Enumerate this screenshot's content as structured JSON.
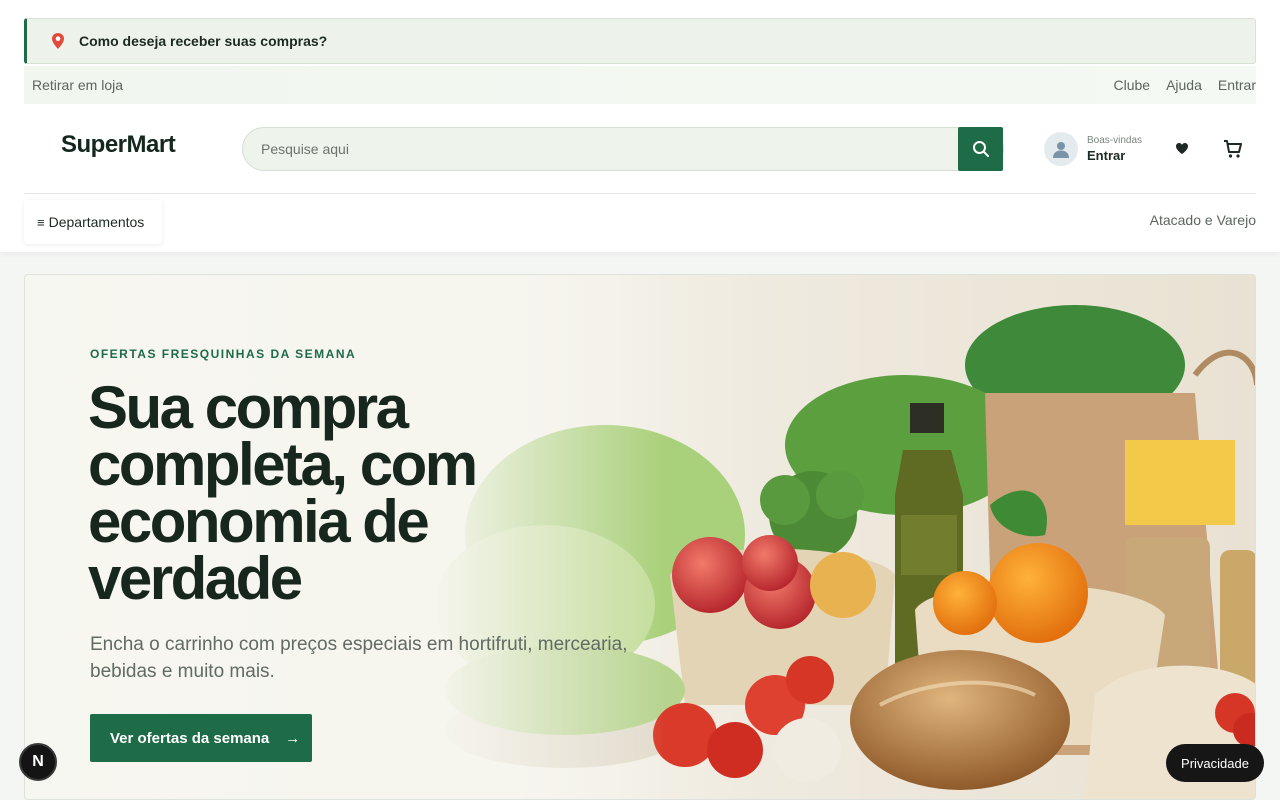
{
  "delivery": {
    "prompt": "Como deseja receber suas compras?",
    "icon": "map-pin-icon"
  },
  "utility": {
    "pickup": "Retirar em loja",
    "links": [
      "Clube",
      "Ajuda",
      "Entrar"
    ]
  },
  "header": {
    "logo": "SuperMart",
    "search_placeholder": "Pesquise aqui",
    "account_greeting": "Boas-vindas",
    "account_action": "Entrar",
    "icons": [
      "search-icon",
      "user-icon",
      "heart-icon",
      "cart-icon"
    ]
  },
  "nav": {
    "departments": "Departamentos",
    "departments_icon": "≡",
    "atacado": "Atacado e Varejo"
  },
  "hero": {
    "eyebrow": "OFERTAS FRESQUINHAS DA SEMANA",
    "headline": "Sua compra completa, com economia de verdade",
    "subtext": "Encha o carrinho com preços especiais em hortifruti, mercearia, bebidas e muito mais.",
    "cta": "Ver ofertas da semana",
    "cta_arrow": "→"
  },
  "floating": {
    "badge": "N",
    "privacy": "Privacidade"
  },
  "colors": {
    "brand": "#1d6b47",
    "dark": "#17271e",
    "muted": "#5b665f"
  }
}
